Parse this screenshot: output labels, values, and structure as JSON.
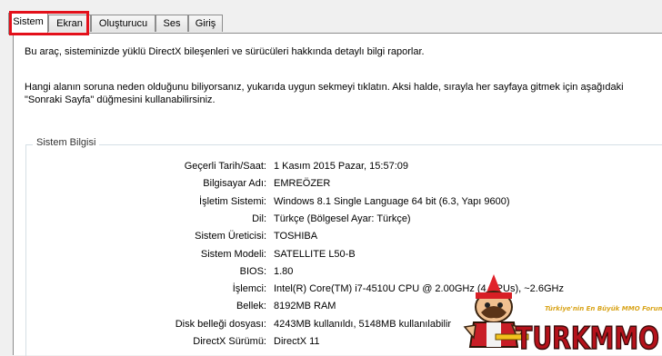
{
  "tabs": [
    "Sistem",
    "Ekran",
    "Oluşturucu",
    "Ses",
    "Giriş"
  ],
  "intro_line1": "Bu araç, sisteminizde yüklü DirectX bileşenleri ve sürücüleri hakkında detaylı bilgi raporlar.",
  "intro_line2": "Hangi alanın soruna neden olduğunu biliyorsanız, yukarıda uygun sekmeyi tıklatın.  Aksi halde, sırayla her sayfaya gitmek için aşağıdaki",
  "intro_line3": "\"Sonraki Sayfa\" düğmesini kullanabilirsiniz.",
  "group_title": "Sistem Bilgisi",
  "rows": [
    {
      "label": "Geçerli Tarih/Saat:",
      "value": "1 Kasım 2015 Pazar, 15:57:09"
    },
    {
      "label": "Bilgisayar Adı:",
      "value": "EMREÖZER"
    },
    {
      "label": "İşletim Sistemi:",
      "value": "Windows 8.1 Single Language 64 bit (6.3, Yapı 9600)"
    },
    {
      "label": "Dil:",
      "value": "Türkçe (Bölgesel Ayar: Türkçe)"
    },
    {
      "label": "Sistem Üreticisi:",
      "value": "TOSHIBA"
    },
    {
      "label": "Sistem Modeli:",
      "value": "SATELLITE L50-B"
    },
    {
      "label": "BIOS:",
      "value": "1.80"
    },
    {
      "label": "İşlemci:",
      "value": "Intel(R) Core(TM) i7-4510U CPU @ 2.00GHz (4 CPUs), ~2.6GHz"
    },
    {
      "label": "Bellek:",
      "value": "8192MB RAM"
    },
    {
      "label": "Disk belleği dosyası:",
      "value": "4243MB kullanıldı, 5148MB kullanılabilir"
    },
    {
      "label": "DirectX Sürümü:",
      "value": "DirectX 11"
    }
  ],
  "watermark": {
    "text": "TURKMMO",
    "tagline": "Türkiye'nin En Büyük MMO Forumu"
  }
}
